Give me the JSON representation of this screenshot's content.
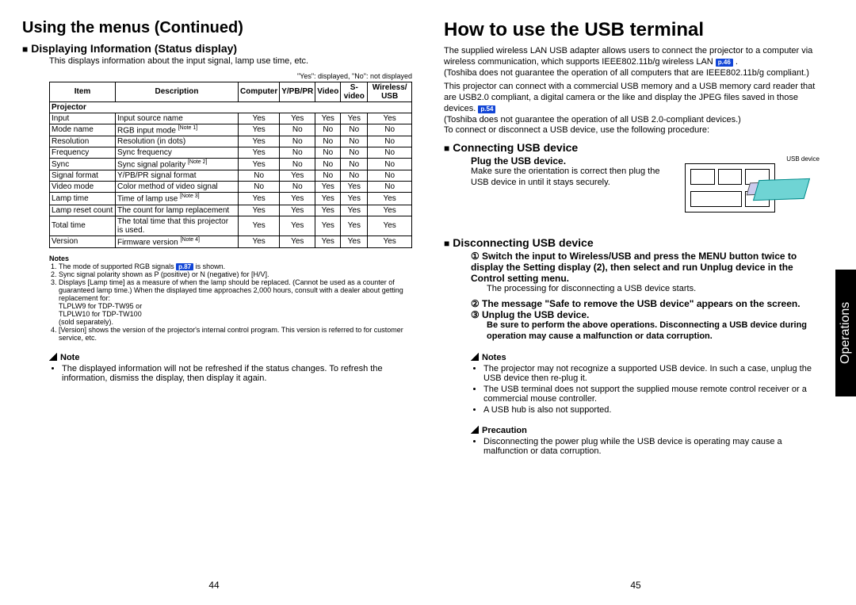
{
  "left": {
    "heading": "Using the menus (Continued)",
    "sect": "Displaying Information (Status display)",
    "intro": "This displays information about the input signal, lamp use time, etc.",
    "legend": "\"Yes\": displayed, \"No\": not displayed",
    "table": {
      "headers": [
        "Item",
        "Description",
        "Computer",
        "Y/PB/PR",
        "Video",
        "S-video",
        "Wireless/ USB"
      ],
      "section": "Projector",
      "rows": [
        {
          "item": "Input",
          "desc": "Input source name",
          "v": [
            "Yes",
            "Yes",
            "Yes",
            "Yes",
            "Yes"
          ]
        },
        {
          "item": "Mode name",
          "desc": "RGB input mode",
          "note": "[Note 1]",
          "v": [
            "Yes",
            "No",
            "No",
            "No",
            "No"
          ]
        },
        {
          "item": "Resolution",
          "desc": "Resolution (in dots)",
          "v": [
            "Yes",
            "No",
            "No",
            "No",
            "No"
          ]
        },
        {
          "item": "Frequency",
          "desc": "Sync frequency",
          "v": [
            "Yes",
            "No",
            "No",
            "No",
            "No"
          ]
        },
        {
          "item": "Sync",
          "desc": "Sync signal polarity",
          "note": "[Note 2]",
          "v": [
            "Yes",
            "No",
            "No",
            "No",
            "No"
          ]
        },
        {
          "item": "Signal format",
          "desc": "Y/PB/PR signal format",
          "v": [
            "No",
            "Yes",
            "No",
            "No",
            "No"
          ]
        },
        {
          "item": "Video mode",
          "desc": "Color method of video signal",
          "v": [
            "No",
            "No",
            "Yes",
            "Yes",
            "No"
          ]
        },
        {
          "item": "Lamp time",
          "desc": "Time of lamp use",
          "note": "[Note 3]",
          "v": [
            "Yes",
            "Yes",
            "Yes",
            "Yes",
            "Yes"
          ]
        },
        {
          "item": "Lamp reset count",
          "desc": "The count for lamp replacement",
          "v": [
            "Yes",
            "Yes",
            "Yes",
            "Yes",
            "Yes"
          ]
        },
        {
          "item": "Total time",
          "desc": "The total time that this projector is used.",
          "v": [
            "Yes",
            "Yes",
            "Yes",
            "Yes",
            "Yes"
          ]
        },
        {
          "item": "Version",
          "desc": "Firmware version",
          "note": "[Note 4]",
          "v": [
            "Yes",
            "Yes",
            "Yes",
            "Yes",
            "Yes"
          ]
        }
      ]
    },
    "notes_label": "Notes",
    "notes": [
      "The mode of supported RGB signals p.87 is shown.",
      "Sync signal polarity shown as P (positive) or N (negative) for [H/V].",
      "Displays [Lamp time] as a measure of when the lamp should be replaced. (Cannot be used as a counter of guaranteed lamp time.) When the displayed time approaches 2,000 hours, consult with a dealer about getting replacement for:\nTLPLW9 for TDP-TW95 or\nTLPLW10 for TDP-TW100\n(sold separately).",
      "[Version] shows the version of the projector's internal control program. This version is referred to for customer service, etc."
    ],
    "note_h": "Note",
    "note_body": "The displayed information will not be refreshed if the status changes. To refresh the information, dismiss the display, then display it again.",
    "pagenum": "44"
  },
  "right": {
    "heading": "How to use the USB terminal",
    "p1": "The supplied wireless LAN USB adapter allows users to connect the projector to a computer via wireless communication, which supports IEEE802.11b/g wireless LAN",
    "pref1": "p.46",
    "p1b": "(Toshiba does not guarantee the operation of all computers that are IEEE802.11b/g compliant.)",
    "p2a": "This projector can connect with a commercial USB memory and a USB memory card reader that are USB2.0 compliant, a digital camera or the like and display the JPEG files saved in those devices.",
    "pref2": "p.54",
    "p2b": "(Toshiba does not guarantee the operation of all USB 2.0-compliant devices.)",
    "p2c": "To connect or disconnect a USB device, use the following procedure:",
    "connect_h": "Connecting USB device",
    "plug_h": "Plug the USB device.",
    "plug_body": "Make sure the orientation is correct then plug the USB device in until it stays securely.",
    "usb_label": "USB device",
    "disc_h": "Disconnecting USB device",
    "step1": "Switch the input to Wireless/USB and press the MENU button twice to display the Setting display (2), then select and run Unplug device in the Control setting menu.",
    "step1sub": "The processing for disconnecting a USB device starts.",
    "step2": "The message \"Safe to remove the USB device\" appears on the screen.",
    "step3": "Unplug the USB device.",
    "step3sub": "Be sure to perform the above operations. Disconnecting a USB device during operation may cause a malfunction or data corruption.",
    "notes_h": "Notes",
    "note_items": [
      "The projector may not recognize a supported USB device. In such a case, unplug the USB device then re-plug it.",
      "The USB terminal does not support the supplied mouse remote control receiver or a commercial mouse controller.",
      "A USB hub is also not supported."
    ],
    "prec_h": "Precaution",
    "prec_body": "Disconnecting the power plug while the USB device is operating may cause a malfunction or data corruption.",
    "pagenum": "45",
    "sidetab": "Operations"
  }
}
